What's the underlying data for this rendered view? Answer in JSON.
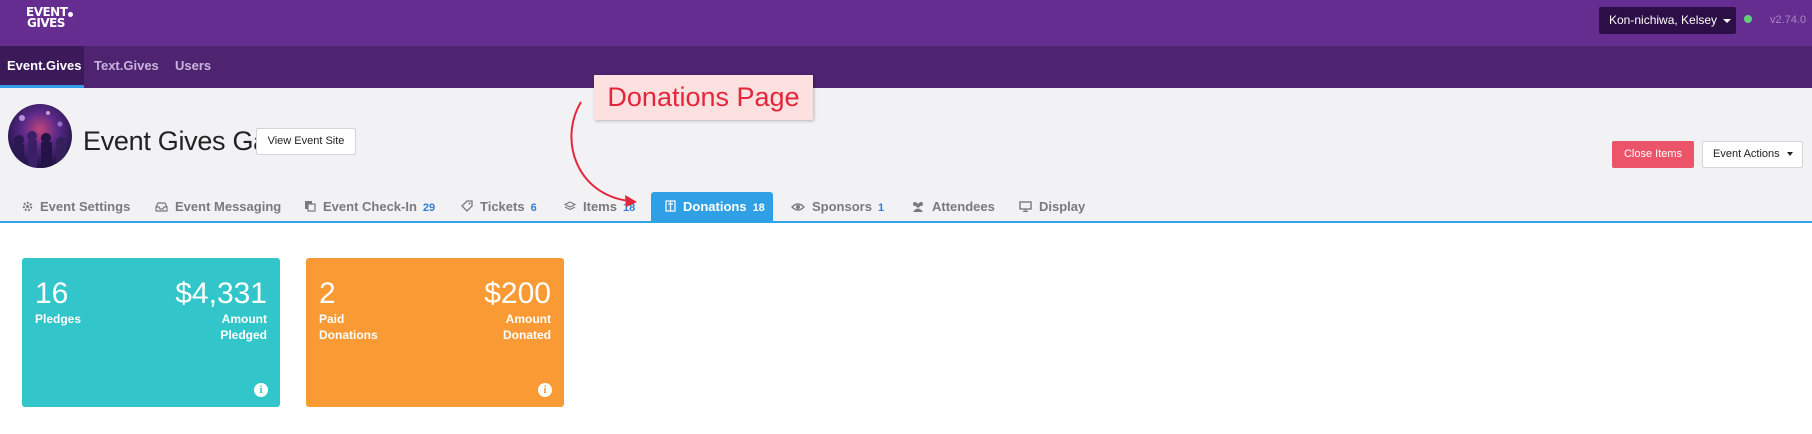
{
  "app": {
    "logo_line1": "EVENT",
    "logo_line2": "GIVES",
    "user_menu_label": "Kon-nichiwa, Kelsey",
    "version": "v2.74.0",
    "status_color": "#5fcf7a"
  },
  "nav": [
    {
      "label": "Event.Gives",
      "active": true
    },
    {
      "label": "Text.Gives",
      "active": false
    },
    {
      "label": "Users",
      "active": false
    }
  ],
  "event": {
    "title": "Event Gives Gala",
    "view_site_label": "View Event Site",
    "close_items_label": "Close Items",
    "event_actions_label": "Event Actions"
  },
  "tabs": [
    {
      "label": "Event Settings",
      "count": "",
      "icon": "gear-icon"
    },
    {
      "label": "Event Messaging",
      "count": "",
      "icon": "inbox-icon"
    },
    {
      "label": "Event Check-In",
      "count": "29",
      "icon": "copy-icon"
    },
    {
      "label": "Tickets",
      "count": "6",
      "icon": "tag-icon"
    },
    {
      "label": "Items",
      "count": "18",
      "icon": "cube-icon"
    },
    {
      "label": "Donations",
      "count": "18",
      "icon": "gift-icon",
      "active": true
    },
    {
      "label": "Sponsors",
      "count": "1",
      "icon": "eye-icon"
    },
    {
      "label": "Attendees",
      "count": "",
      "icon": "users-icon"
    },
    {
      "label": "Display",
      "count": "",
      "icon": "monitor-icon"
    }
  ],
  "annotation": {
    "text": "Donations Page",
    "color": "#e3263a"
  },
  "cards": [
    {
      "left_value": "16",
      "left_label": "Pledges",
      "right_value": "$4,331",
      "right_label": "Amount Pledged",
      "color": "#32c5c9"
    },
    {
      "left_value": "2",
      "left_label": "Paid Donations",
      "right_value": "$200",
      "right_label": "Amount Donated",
      "color": "#f99a35"
    }
  ],
  "colors": {
    "topbar": "#662d91",
    "navbar": "#4e2370",
    "accent": "#2fa0e6",
    "danger": "#ec5569"
  }
}
